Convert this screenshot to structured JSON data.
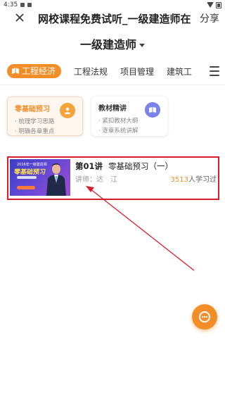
{
  "status_bar": {
    "time": "4:35"
  },
  "titlebar": {
    "close_icon": "close-icon",
    "title": "网校课程免费试听_一级建造师在",
    "share_label": "分享"
  },
  "page_heading": {
    "title": "一级建造师"
  },
  "tabs": [
    {
      "label": "工程经济",
      "active": true
    },
    {
      "label": "工程法规"
    },
    {
      "label": "项目管理"
    },
    {
      "label": "建筑工"
    }
  ],
  "cards": [
    {
      "title": "零基础预习",
      "lines": [
        "· 梳理学习思路",
        "· 明确各章重点"
      ],
      "accent": "#f28d27"
    },
    {
      "title": "教材精讲",
      "lines": [
        "· 紧扣教材大纲",
        "· 逐章系统讲解"
      ],
      "accent": "#7b83e8"
    }
  ],
  "course": {
    "lecture": "第01讲",
    "name": "零基础预习（一）",
    "teacher": "讲师：达　江",
    "student_count": "3513",
    "student_suffix": "人学习过",
    "thumb_top": "2026年一级建造师",
    "thumb_main": "零基础预习"
  },
  "colors": {
    "accent": "#f28d27",
    "highlight_red": "#d81e2c"
  }
}
